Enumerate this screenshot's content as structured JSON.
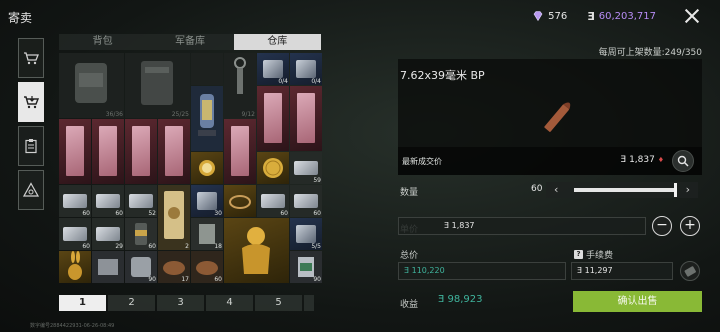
{
  "header": {
    "title": "寄卖",
    "gems": "576",
    "coins": "60,203,717",
    "coin_symbol": "Ǝ"
  },
  "leftbar": {
    "items": [
      "cart-icon",
      "sell-cart-icon",
      "clipboard-icon",
      "triangle-eye-icon"
    ],
    "active_index": 1
  },
  "inventory": {
    "tabs": [
      "背包",
      "军备库",
      "仓库"
    ],
    "active_tab": 2,
    "counts": {
      "c1": "36/36",
      "c2": "25/25",
      "c3": "9/12",
      "c4": "0/4",
      "c5": "0/4",
      "c6": "59",
      "c7": "60",
      "c8": "60",
      "c9": "52",
      "c10": "30",
      "c11": "60",
      "c12": "60",
      "c13": "60",
      "c14": "29",
      "c15": "60",
      "c16": "2",
      "c17": "18",
      "c18": "5/5",
      "c19": "90",
      "c20": "17",
      "c21": "60",
      "c22": "90"
    },
    "pages": [
      "1",
      "2",
      "3",
      "4",
      "5"
    ],
    "active_page": 0
  },
  "footer_id": "数字编号2884422931-06-26-08:49",
  "detail": {
    "weekly_limit": "每周可上架数量:249/350",
    "item_name": "7.62x39毫米 BP",
    "latest_price_label": "最新成交价",
    "latest_price": "1,837",
    "quantity_label": "数量",
    "quantity": "60",
    "quantity_fraction": 1.0,
    "unit_price_label": "单价",
    "unit_price": "1,837",
    "total_label": "总价",
    "total": "110,220",
    "fee_label": "手续费",
    "fee": "11,297",
    "earn_label": "收益",
    "earn": "98,923",
    "confirm_label": "确认出售",
    "colors": {
      "accent_green": "#89b936",
      "earn_teal": "#3fb39c",
      "coin_purple": "#b78cf5"
    }
  }
}
